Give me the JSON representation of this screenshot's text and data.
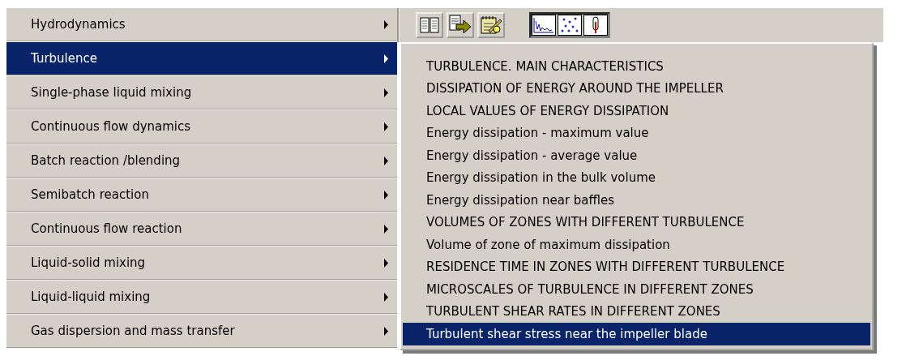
{
  "menu": {
    "items": [
      {
        "label": "Hydrodynamics",
        "selected": false
      },
      {
        "label": "Turbulence",
        "selected": true
      },
      {
        "label": "Single-phase liquid mixing",
        "selected": false
      },
      {
        "label": "Continuous flow dynamics",
        "selected": false
      },
      {
        "label": "Batch reaction /blending",
        "selected": false
      },
      {
        "label": "Semibatch reaction",
        "selected": false
      },
      {
        "label": "Continuous flow reaction",
        "selected": false
      },
      {
        "label": "Liquid-solid mixing",
        "selected": false
      },
      {
        "label": "Liquid-liquid mixing",
        "selected": false
      },
      {
        "label": "Gas dispersion and mass transfer",
        "selected": false
      }
    ]
  },
  "toolbar": {
    "buttons": [
      {
        "kind": "book",
        "pressed": false
      },
      {
        "kind": "export",
        "pressed": false
      },
      {
        "kind": "notes",
        "pressed": false
      },
      {
        "kind": "charts",
        "pressed": true
      }
    ]
  },
  "submenu": {
    "items": [
      {
        "label": "TURBULENCE. MAIN CHARACTERISTICS",
        "selected": false
      },
      {
        "label": "DISSIPATION OF ENERGY AROUND THE IMPELLER",
        "selected": false
      },
      {
        "label": "LOCAL VALUES OF ENERGY DISSIPATION",
        "selected": false
      },
      {
        "label": "Energy dissipation - maximum value",
        "selected": false
      },
      {
        "label": "Energy dissipation - average value",
        "selected": false
      },
      {
        "label": "Energy dissipation in the bulk volume",
        "selected": false
      },
      {
        "label": "Energy dissipation near baffles",
        "selected": false
      },
      {
        "label": "VOLUMES OF ZONES WITH DIFFERENT TURBULENCE",
        "selected": false
      },
      {
        "label": "Volume of zone of maximum dissipation",
        "selected": false
      },
      {
        "label": "RESIDENCE TIME IN ZONES WITH DIFFERENT TURBULENCE",
        "selected": false
      },
      {
        "label": "MICROSCALES OF TURBULENCE IN DIFFERENT ZONES",
        "selected": false
      },
      {
        "label": "TURBULENT SHEAR RATES IN DIFFERENT ZONES",
        "selected": false
      },
      {
        "label": "Turbulent shear stress near the impeller blade",
        "selected": true
      }
    ]
  }
}
